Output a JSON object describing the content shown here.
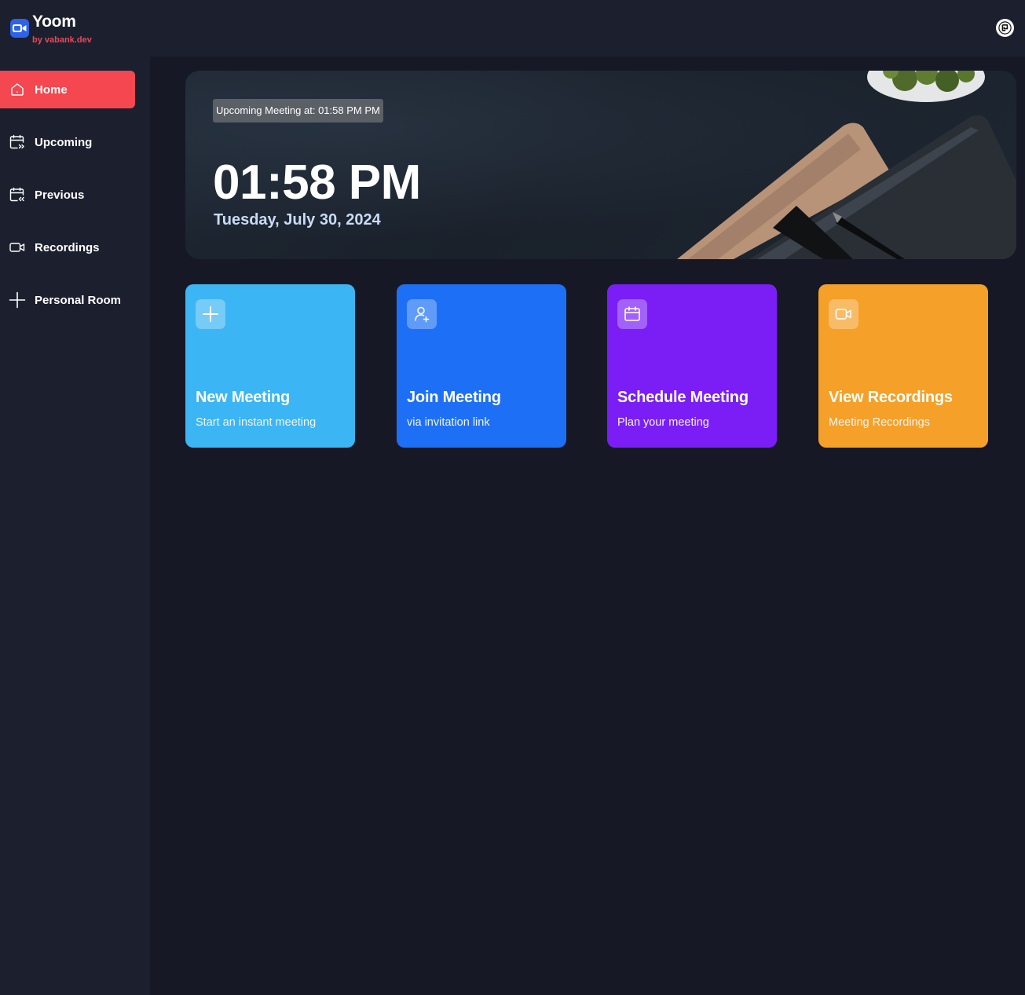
{
  "app": {
    "title": "Yoom",
    "subtitle": "by vabank.dev",
    "accent": "#f5474f"
  },
  "header": {
    "user_avatar_icon": "user-avatar-icon"
  },
  "sidebar": {
    "items": [
      {
        "label": "Home",
        "icon": "home-icon",
        "active": true
      },
      {
        "label": "Upcoming",
        "icon": "calendar-upcoming-icon",
        "active": false
      },
      {
        "label": "Previous",
        "icon": "calendar-previous-icon",
        "active": false
      },
      {
        "label": "Recordings",
        "icon": "video-icon",
        "active": false
      },
      {
        "label": "Personal Room",
        "icon": "plus-icon",
        "active": false
      }
    ]
  },
  "hero": {
    "upcoming_badge": "Upcoming Meeting at: 01:58 PM PM",
    "time": "01:58 PM",
    "date": "Tuesday, July 30, 2024"
  },
  "cards": [
    {
      "title": "New Meeting",
      "subtitle": "Start an instant meeting",
      "icon": "plus-icon",
      "color": "#3bb5f4"
    },
    {
      "title": "Join Meeting",
      "subtitle": "via invitation link",
      "icon": "user-plus-icon",
      "color": "#1d70f5"
    },
    {
      "title": "Schedule Meeting",
      "subtitle": "Plan your meeting",
      "icon": "calendar-icon",
      "color": "#7a1ef5"
    },
    {
      "title": "View Recordings",
      "subtitle": "Meeting Recordings",
      "icon": "video-icon",
      "color": "#f5a028"
    }
  ]
}
